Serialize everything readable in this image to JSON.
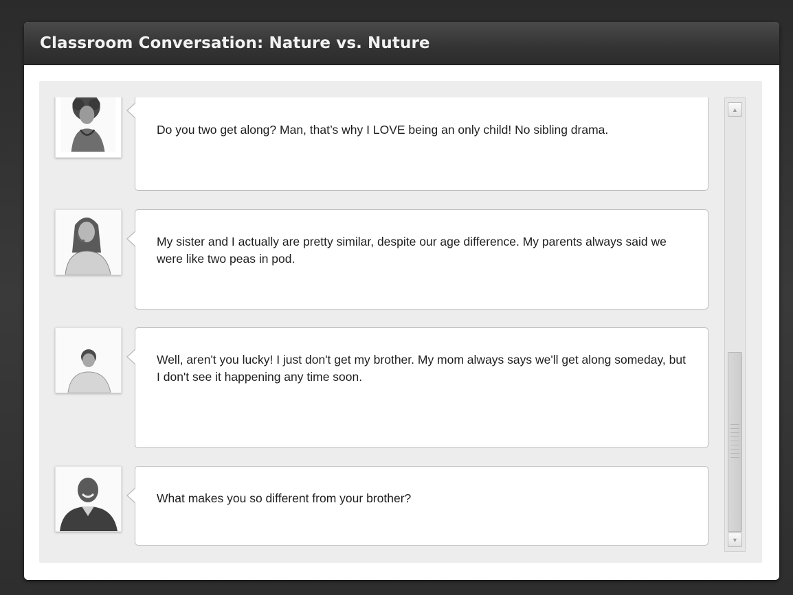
{
  "window": {
    "title": "Classroom Conversation: Nature vs. Nuture"
  },
  "messages": [
    {
      "avatar": "curly-haired-woman-avatar",
      "text": "Do you two get along? Man, that’s why I LOVE being an only child! No sibling drama."
    },
    {
      "avatar": "long-haired-woman-avatar",
      "text": "My sister and I actually are pretty similar, despite our age difference. My parents always said we were like two peas in pod."
    },
    {
      "avatar": "young-man-avatar",
      "text": "Well, aren't you lucky! I just don't get my brother. My mom always says we'll get along someday, but I don't see it happening any time soon."
    },
    {
      "avatar": "smiling-man-avatar",
      "text": "What makes you so different from your brother?"
    }
  ],
  "scrollbar": {
    "up_icon": "triangle-up-icon",
    "down_icon": "triangle-down-icon",
    "up_glyph": "▲",
    "down_glyph": "▼"
  }
}
